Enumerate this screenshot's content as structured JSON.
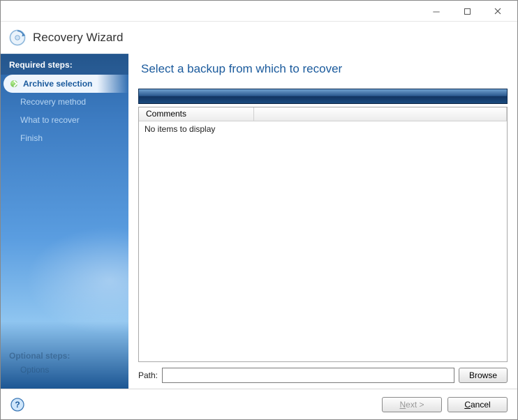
{
  "window": {
    "title": "Recovery Wizard"
  },
  "sidebar": {
    "required_header": "Required steps:",
    "steps": [
      {
        "label": "Archive selection",
        "active": true
      },
      {
        "label": "Recovery method",
        "active": false
      },
      {
        "label": "What to recover",
        "active": false
      },
      {
        "label": "Finish",
        "active": false
      }
    ],
    "optional_header": "Optional steps:",
    "optional_sub": "Options"
  },
  "main": {
    "title": "Select a backup from which to recover",
    "columns": {
      "comments": "Comments",
      "col2": ""
    },
    "empty_text": "No items to display",
    "path_label": "Path:",
    "path_value": "",
    "browse_label": "Browse"
  },
  "footer": {
    "next_prefix": "N",
    "next_rest": "ext >",
    "cancel_prefix": "C",
    "cancel_rest": "ancel",
    "next_enabled": false
  },
  "icons": {
    "app": "recovery-wizard-icon",
    "help": "help-icon"
  }
}
